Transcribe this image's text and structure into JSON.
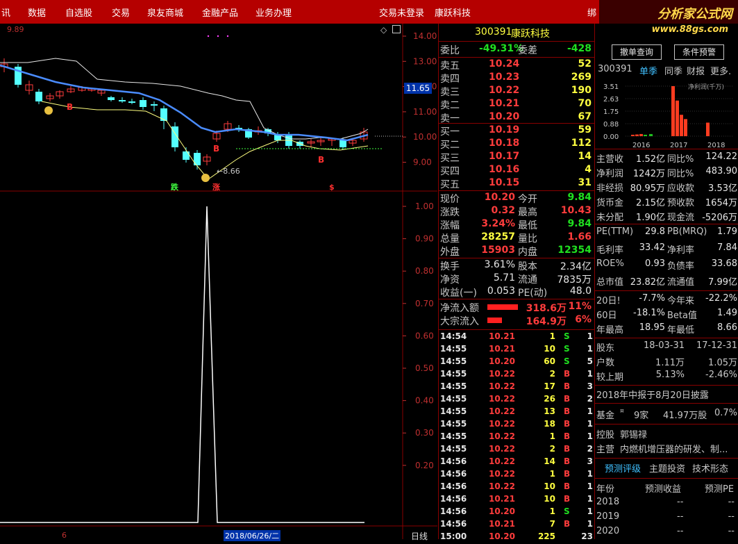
{
  "menu": {
    "items": [
      "讯",
      "数据",
      "自选股",
      "交易",
      "泉友商城",
      "金融产品",
      "业务办理"
    ],
    "trade_status": "交易未登录",
    "stock_name": "康跃科技",
    "extra": "绑",
    "logo_text": "分析家公式网",
    "logo_url": "www.88gs.com"
  },
  "chart": {
    "price_axis": [
      "14.00",
      "13.00",
      "12.00",
      "11.00",
      "10.00",
      "9.00"
    ],
    "current_price_tag": "11.65",
    "top_left_value": "9.89",
    "low_annot": "8.66",
    "markers_b": [
      "B",
      "B",
      "B"
    ],
    "marker_die": "跌",
    "marker_zhang": "涨",
    "marker_s": "$",
    "ind_axis": [
      "1.00",
      "0.90",
      "0.80",
      "0.70",
      "0.60",
      "0.50",
      "0.40",
      "0.30",
      "0.20"
    ],
    "bottom_date": "2018/06/26/二",
    "bottom_left": "6",
    "bottom_right": "日线"
  },
  "quote": {
    "code": "300391",
    "name": "康跃科技",
    "weibi_label": "委比",
    "weibi": "-49.31%",
    "weicha_label": "委差",
    "weicha": "-428",
    "asks": [
      {
        "label": "卖五",
        "price": "10.24",
        "vol": "52"
      },
      {
        "label": "卖四",
        "price": "10.23",
        "vol": "269"
      },
      {
        "label": "卖三",
        "price": "10.22",
        "vol": "190"
      },
      {
        "label": "卖二",
        "price": "10.21",
        "vol": "70"
      },
      {
        "label": "卖一",
        "price": "10.20",
        "vol": "67"
      }
    ],
    "bids": [
      {
        "label": "买一",
        "price": "10.19",
        "vol": "59"
      },
      {
        "label": "买二",
        "price": "10.18",
        "vol": "112"
      },
      {
        "label": "买三",
        "price": "10.17",
        "vol": "14"
      },
      {
        "label": "买四",
        "price": "10.16",
        "vol": "4"
      },
      {
        "label": "买五",
        "price": "10.15",
        "vol": "31"
      }
    ],
    "stats1": [
      {
        "l1": "现价",
        "v1": "10.20",
        "c1": "red",
        "l2": "今开",
        "v2": "9.84",
        "c2": "grn"
      },
      {
        "l1": "涨跌",
        "v1": "0.32",
        "c1": "red",
        "l2": "最高",
        "v2": "10.43",
        "c2": "red"
      },
      {
        "l1": "涨幅",
        "v1": "3.24%",
        "c1": "red",
        "l2": "最低",
        "v2": "9.84",
        "c2": "grn"
      },
      {
        "l1": "总量",
        "v1": "28257",
        "c1": "yel",
        "l2": "量比",
        "v2": "1.66",
        "c2": "red"
      },
      {
        "l1": "外盘",
        "v1": "15903",
        "c1": "red",
        "l2": "内盘",
        "v2": "12354",
        "c2": "grn"
      }
    ],
    "stats2": [
      {
        "l1": "换手",
        "v1": "3.61%",
        "l2": "股本",
        "v2": "2.34亿"
      },
      {
        "l1": "净资",
        "v1": "5.71",
        "l2": "流通",
        "v2": "7835万"
      },
      {
        "l1": "收益(一)",
        "v1": "0.053",
        "l2": "PE(动)",
        "v2": "48.0"
      }
    ],
    "flows": [
      {
        "label": "净流入额",
        "amount": "318.6万",
        "pct": "11%",
        "bar": 0.95
      },
      {
        "label": "大宗流入",
        "amount": "164.9万",
        "pct": "6%",
        "bar": 0.45
      }
    ],
    "ticks": [
      {
        "t": "14:54",
        "p": "10.21",
        "v": "1",
        "d": "S",
        "n": "1"
      },
      {
        "t": "14:55",
        "p": "10.21",
        "v": "10",
        "d": "S",
        "n": "1"
      },
      {
        "t": "14:55",
        "p": "10.20",
        "v": "60",
        "d": "S",
        "n": "5"
      },
      {
        "t": "14:55",
        "p": "10.22",
        "v": "2",
        "d": "B",
        "n": "1"
      },
      {
        "t": "14:55",
        "p": "10.22",
        "v": "17",
        "d": "B",
        "n": "3"
      },
      {
        "t": "14:55",
        "p": "10.22",
        "v": "26",
        "d": "B",
        "n": "2"
      },
      {
        "t": "14:55",
        "p": "10.22",
        "v": "13",
        "d": "B",
        "n": "1"
      },
      {
        "t": "14:55",
        "p": "10.22",
        "v": "18",
        "d": "B",
        "n": "1"
      },
      {
        "t": "14:55",
        "p": "10.22",
        "v": "1",
        "d": "B",
        "n": "1"
      },
      {
        "t": "14:55",
        "p": "10.22",
        "v": "2",
        "d": "B",
        "n": "2"
      },
      {
        "t": "14:56",
        "p": "10.22",
        "v": "14",
        "d": "B",
        "n": "3"
      },
      {
        "t": "14:56",
        "p": "10.22",
        "v": "1",
        "d": "B",
        "n": "1"
      },
      {
        "t": "14:56",
        "p": "10.22",
        "v": "10",
        "d": "B",
        "n": "1"
      },
      {
        "t": "14:56",
        "p": "10.21",
        "v": "10",
        "d": "B",
        "n": "1"
      },
      {
        "t": "14:56",
        "p": "10.20",
        "v": "1",
        "d": "S",
        "n": "1"
      },
      {
        "t": "14:56",
        "p": "10.21",
        "v": "7",
        "d": "B",
        "n": "1"
      },
      {
        "t": "15:00",
        "p": "10.20",
        "v": "225",
        "d": "",
        "n": "23"
      }
    ]
  },
  "f10": {
    "btn_cancel": "撤单查询",
    "btn_alert": "条件预警",
    "code": "300391",
    "tabs": [
      "单季",
      "同季",
      "财报",
      "更多."
    ],
    "mini_chart": {
      "type": "bar",
      "y_ticks": [
        "3.51",
        "2.63",
        "1.75",
        "0.88",
        "0.00"
      ],
      "x_labels": [
        "2016",
        "2017",
        "2018"
      ],
      "legend": "净利润(千万)",
      "values": [
        0.1,
        0.12,
        0.15,
        0.1,
        0.15,
        3.51,
        2.5,
        1.5,
        1.2,
        0.95
      ]
    },
    "rows1": [
      {
        "l1": "主营收",
        "v1": "1.52亿",
        "l2": "同比%",
        "v2": "124.22"
      },
      {
        "l1": "净利润",
        "v1": "1242万",
        "l2": "同比%",
        "v2": "483.90"
      },
      {
        "l1": "非经损",
        "v1": "80.95万",
        "l2": "应收款",
        "v2": "3.53亿"
      },
      {
        "l1": "货币金",
        "v1": "2.15亿",
        "l2": "预收款",
        "v2": "1654万"
      },
      {
        "l1": "未分配",
        "v1": "1.90亿",
        "l2": "现金流",
        "v2": "-5206万"
      }
    ],
    "rows2": [
      {
        "l1": "PE(TTM)",
        "v1": "29.8",
        "l2": "PB(MRQ)",
        "v2": "1.79"
      },
      {
        "l1": "毛利率",
        "v1": "33.42",
        "l2": "净利率",
        "v2": "7.84"
      },
      {
        "l1": "ROE%",
        "v1": "0.93",
        "l2": "负债率",
        "v2": "33.68"
      },
      {
        "l1": "总市值",
        "v1": "23.82亿",
        "l2": "流通值",
        "v2": "7.99亿"
      }
    ],
    "rows3": [
      {
        "l1": "20日!",
        "v1": "-7.7%",
        "l2": "今年来",
        "v2": "-22.2%"
      },
      {
        "l1": "60日",
        "v1": "-18.1%",
        "l2": "Beta值",
        "v2": "1.49"
      },
      {
        "l1": "年最高",
        "v1": "18.95",
        "l2": "年最低",
        "v2": "8.66"
      }
    ],
    "holders": {
      "label": "股东",
      "d1": "18-03-31",
      "d2": "17-12-31",
      "hu_label": "户数",
      "hu1": "1.11万",
      "hu2": "1.05万",
      "cmp_label": "较上期",
      "cmp1": "5.13%",
      "cmp2": "-2.46%"
    },
    "report_note": "2018年中报于8月20日披露",
    "fund": {
      "label": "基金",
      "count": "9家",
      "shares": "41.97万股",
      "pct": "0.7%"
    },
    "control": {
      "label": "控股",
      "value": "郭锡禄"
    },
    "business": {
      "label": "主营",
      "value": "内燃机增压器的研发、制..."
    },
    "bottom_tabs": [
      "预测评级",
      "主题投资",
      "技术形态"
    ],
    "forecast": {
      "headers": [
        "年份",
        "预测收益",
        "预测PE"
      ],
      "rows": [
        {
          "year": "2018",
          "eps": "--",
          "pe": "--"
        },
        {
          "year": "2019",
          "eps": "--",
          "pe": "--"
        },
        {
          "year": "2020",
          "eps": "--",
          "pe": "--"
        }
      ]
    }
  }
}
